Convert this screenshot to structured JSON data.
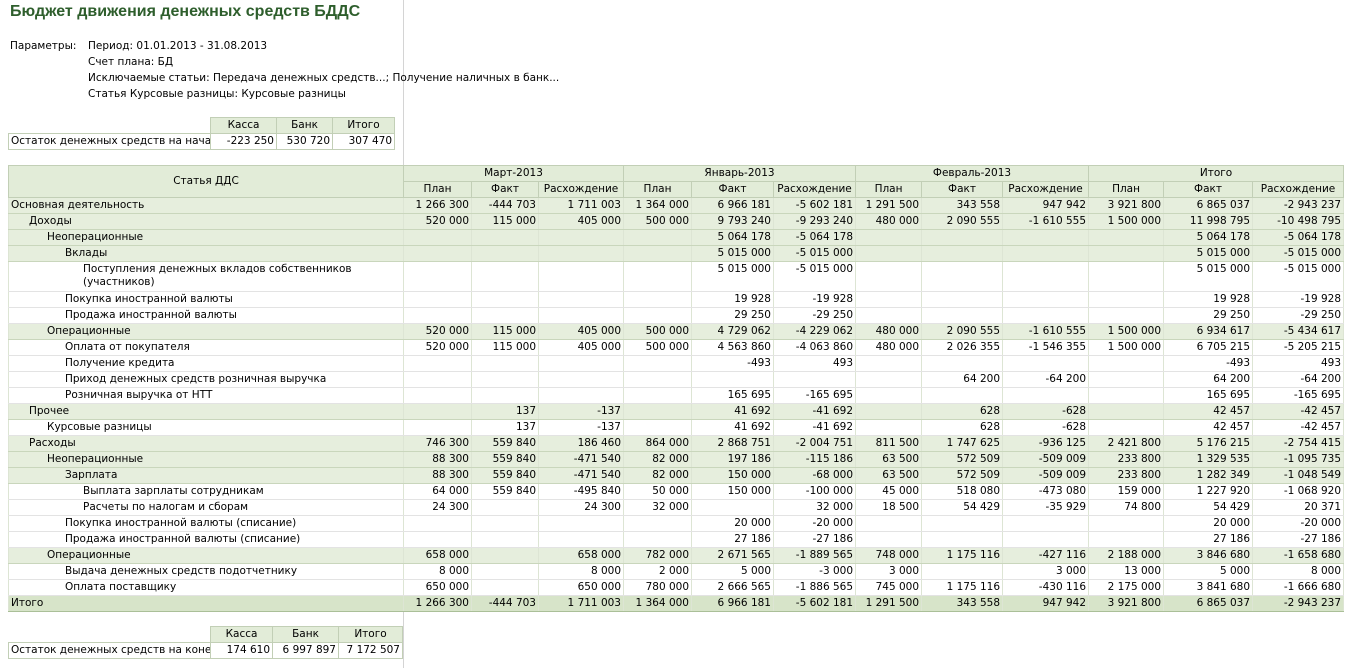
{
  "report": {
    "title": "Бюджет движения денежных средств БДДС",
    "params_label": "Параметры:",
    "params": [
      "Период: 01.01.2013 - 31.08.2013",
      "Счет плана: БД",
      "Исключаемые статьи: Передача денежных средств...; Получение наличных в банк...",
      "Статья Курсовые разницы: Курсовые разницы"
    ]
  },
  "start_balance": {
    "headers": [
      "Касса",
      "Банк",
      "Итого"
    ],
    "label": "Остаток денежных средств на начало",
    "values": [
      "-223 250",
      "530 720",
      "307 470"
    ]
  },
  "end_balance": {
    "headers": [
      "Касса",
      "Банк",
      "Итого"
    ],
    "label": "Остаток денежных средств на конец",
    "values": [
      "174 610",
      "6 997 897",
      "7 172 507"
    ]
  },
  "main_table": {
    "article_header": "Статья ДДС",
    "periods": [
      "Март-2013",
      "Январь-2013",
      "Февраль-2013",
      "Итого"
    ],
    "subheaders": [
      "План",
      "Факт",
      "Расхождение"
    ],
    "rows": [
      {
        "name": "Основная деятельность",
        "level": 0,
        "g": true,
        "v": [
          "1 266 300",
          "-444 703",
          "1 711 003",
          "1 364 000",
          "6 966 181",
          "-5 602 181",
          "1 291 500",
          "343 558",
          "947 942",
          "3 921 800",
          "6 865 037",
          "-2 943 237"
        ]
      },
      {
        "name": "Доходы",
        "level": 1,
        "g": true,
        "v": [
          "520 000",
          "115 000",
          "405 000",
          "500 000",
          "9 793 240",
          "-9 293 240",
          "480 000",
          "2 090 555",
          "-1 610 555",
          "1 500 000",
          "11 998 795",
          "-10 498 795"
        ]
      },
      {
        "name": "Неоперационные",
        "level": 2,
        "g": true,
        "v": [
          "",
          "",
          "",
          "",
          "5 064 178",
          "-5 064 178",
          "",
          "",
          "",
          "",
          "5 064 178",
          "-5 064 178"
        ]
      },
      {
        "name": "Вклады",
        "level": 3,
        "g": true,
        "v": [
          "",
          "",
          "",
          "",
          "5 015 000",
          "-5 015 000",
          "",
          "",
          "",
          "",
          "5 015 000",
          "-5 015 000"
        ]
      },
      {
        "name": "Поступления денежных вкладов собственников (участников)",
        "level": 4,
        "g": false,
        "tall": true,
        "v": [
          "",
          "",
          "",
          "",
          "5 015 000",
          "-5 015 000",
          "",
          "",
          "",
          "",
          "5 015 000",
          "-5 015 000"
        ]
      },
      {
        "name": "Покупка иностранной валюты",
        "level": 3,
        "g": false,
        "v": [
          "",
          "",
          "",
          "",
          "19 928",
          "-19 928",
          "",
          "",
          "",
          "",
          "19 928",
          "-19 928"
        ]
      },
      {
        "name": "Продажа иностранной валюты",
        "level": 3,
        "g": false,
        "v": [
          "",
          "",
          "",
          "",
          "29 250",
          "-29 250",
          "",
          "",
          "",
          "",
          "29 250",
          "-29 250"
        ]
      },
      {
        "name": "Операционные",
        "level": 2,
        "g": true,
        "v": [
          "520 000",
          "115 000",
          "405 000",
          "500 000",
          "4 729 062",
          "-4 229 062",
          "480 000",
          "2 090 555",
          "-1 610 555",
          "1 500 000",
          "6 934 617",
          "-5 434 617"
        ]
      },
      {
        "name": "Оплата от покупателя",
        "level": 3,
        "g": false,
        "v": [
          "520 000",
          "115 000",
          "405 000",
          "500 000",
          "4 563 860",
          "-4 063 860",
          "480 000",
          "2 026 355",
          "-1 546 355",
          "1 500 000",
          "6 705 215",
          "-5 205 215"
        ]
      },
      {
        "name": "Получение кредита",
        "level": 3,
        "g": false,
        "v": [
          "",
          "",
          "",
          "",
          "-493",
          "493",
          "",
          "",
          "",
          "",
          "-493",
          "493"
        ]
      },
      {
        "name": "Приход денежных средств розничная выручка",
        "level": 3,
        "g": false,
        "v": [
          "",
          "",
          "",
          "",
          "",
          "",
          "",
          "64 200",
          "-64 200",
          "",
          "64 200",
          "-64 200"
        ]
      },
      {
        "name": "Розничная выручка от НТТ",
        "level": 3,
        "g": false,
        "v": [
          "",
          "",
          "",
          "",
          "165 695",
          "-165 695",
          "",
          "",
          "",
          "",
          "165 695",
          "-165 695"
        ]
      },
      {
        "name": "Прочее",
        "level": 1,
        "g": true,
        "v": [
          "",
          "137",
          "-137",
          "",
          "41 692",
          "-41 692",
          "",
          "628",
          "-628",
          "",
          "42 457",
          "-42 457"
        ]
      },
      {
        "name": "Курсовые разницы",
        "level": 2,
        "g": false,
        "v": [
          "",
          "137",
          "-137",
          "",
          "41 692",
          "-41 692",
          "",
          "628",
          "-628",
          "",
          "42 457",
          "-42 457"
        ]
      },
      {
        "name": "Расходы",
        "level": 1,
        "g": true,
        "v": [
          "746 300",
          "559 840",
          "186 460",
          "864 000",
          "2 868 751",
          "-2 004 751",
          "811 500",
          "1 747 625",
          "-936 125",
          "2 421 800",
          "5 176 215",
          "-2 754 415"
        ]
      },
      {
        "name": "Неоперационные",
        "level": 2,
        "g": true,
        "v": [
          "88 300",
          "559 840",
          "-471 540",
          "82 000",
          "197 186",
          "-115 186",
          "63 500",
          "572 509",
          "-509 009",
          "233 800",
          "1 329 535",
          "-1 095 735"
        ]
      },
      {
        "name": "Зарплата",
        "level": 3,
        "g": true,
        "v": [
          "88 300",
          "559 840",
          "-471 540",
          "82 000",
          "150 000",
          "-68 000",
          "63 500",
          "572 509",
          "-509 009",
          "233 800",
          "1 282 349",
          "-1 048 549"
        ]
      },
      {
        "name": "Выплата зарплаты сотрудникам",
        "level": 4,
        "g": false,
        "v": [
          "64 000",
          "559 840",
          "-495 840",
          "50 000",
          "150 000",
          "-100 000",
          "45 000",
          "518 080",
          "-473 080",
          "159 000",
          "1 227 920",
          "-1 068 920"
        ]
      },
      {
        "name": "Расчеты по налогам и сборам",
        "level": 4,
        "g": false,
        "v": [
          "24 300",
          "",
          "24 300",
          "32 000",
          "",
          "32 000",
          "18 500",
          "54 429",
          "-35 929",
          "74 800",
          "54 429",
          "20 371"
        ]
      },
      {
        "name": "Покупка иностранной валюты (списание)",
        "level": 3,
        "g": false,
        "v": [
          "",
          "",
          "",
          "",
          "20 000",
          "-20 000",
          "",
          "",
          "",
          "",
          "20 000",
          "-20 000"
        ]
      },
      {
        "name": "Продажа иностранной валюты (списание)",
        "level": 3,
        "g": false,
        "v": [
          "",
          "",
          "",
          "",
          "27 186",
          "-27 186",
          "",
          "",
          "",
          "",
          "27 186",
          "-27 186"
        ]
      },
      {
        "name": "Операционные",
        "level": 2,
        "g": true,
        "v": [
          "658 000",
          "",
          "658 000",
          "782 000",
          "2 671 565",
          "-1 889 565",
          "748 000",
          "1 175 116",
          "-427 116",
          "2 188 000",
          "3 846 680",
          "-1 658 680"
        ]
      },
      {
        "name": "Выдача денежных средств подотчетнику",
        "level": 3,
        "g": false,
        "v": [
          "8 000",
          "",
          "8 000",
          "2 000",
          "5 000",
          "-3 000",
          "3 000",
          "",
          "3 000",
          "13 000",
          "5 000",
          "8 000"
        ]
      },
      {
        "name": "Оплата поставщику",
        "level": 3,
        "g": false,
        "v": [
          "650 000",
          "",
          "650 000",
          "780 000",
          "2 666 565",
          "-1 886 565",
          "745 000",
          "1 175 116",
          "-430 116",
          "2 175 000",
          "3 841 680",
          "-1 666 680"
        ]
      },
      {
        "name": "Итого",
        "level": 0,
        "total": true,
        "v": [
          "1 266 300",
          "-444 703",
          "1 711 003",
          "1 364 000",
          "6 966 181",
          "-5 602 181",
          "1 291 500",
          "343 558",
          "947 942",
          "3 921 800",
          "6 865 037",
          "-2 943 237"
        ]
      }
    ]
  }
}
